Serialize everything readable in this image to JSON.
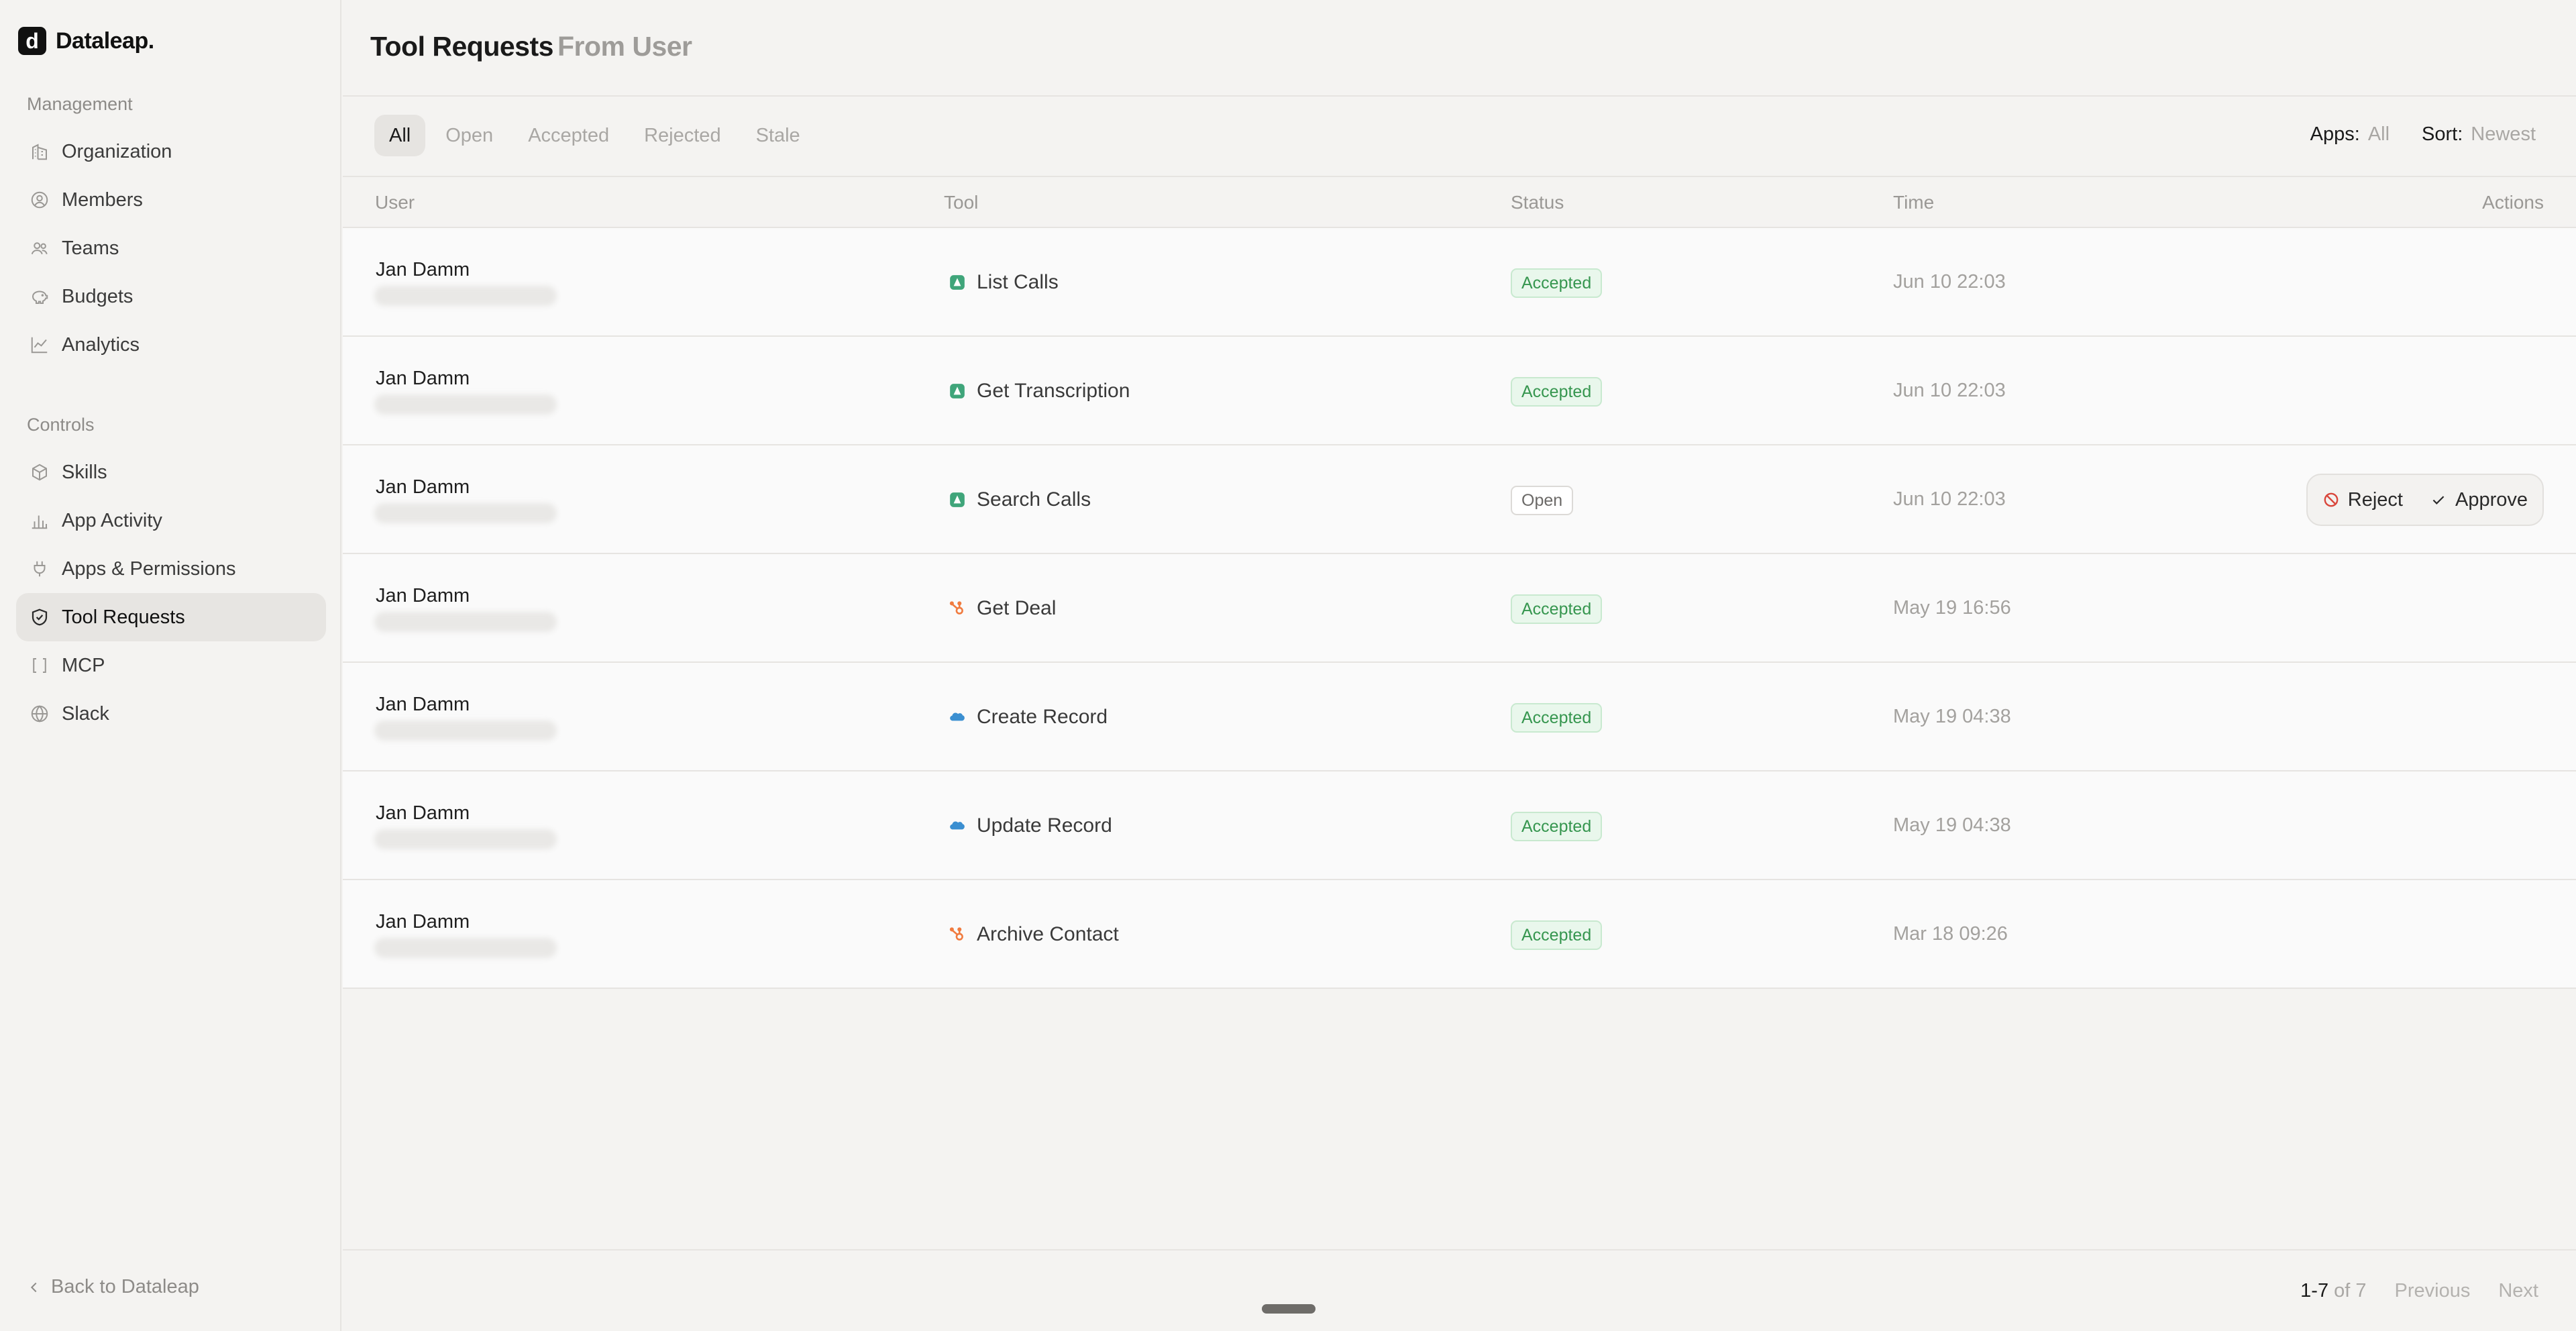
{
  "brand": {
    "logo_letter": "d",
    "name": "Dataleap."
  },
  "sidebar": {
    "sections": [
      {
        "label": "Management",
        "items": [
          {
            "label": "Organization",
            "icon": "building-icon"
          },
          {
            "label": "Members",
            "icon": "user-circle-icon"
          },
          {
            "label": "Teams",
            "icon": "users-icon"
          },
          {
            "label": "Budgets",
            "icon": "piggy-bank-icon"
          },
          {
            "label": "Analytics",
            "icon": "line-chart-icon"
          }
        ]
      },
      {
        "label": "Controls",
        "items": [
          {
            "label": "Skills",
            "icon": "cube-icon"
          },
          {
            "label": "App Activity",
            "icon": "bar-chart-icon"
          },
          {
            "label": "Apps & Permissions",
            "icon": "plug-icon"
          },
          {
            "label": "Tool Requests",
            "icon": "shield-check-icon",
            "active": true
          },
          {
            "label": "MCP",
            "icon": "brackets-icon"
          },
          {
            "label": "Slack",
            "icon": "globe-icon"
          }
        ]
      }
    ],
    "back_label": "Back to Dataleap"
  },
  "header": {
    "title": "Tool Requests",
    "subtitle": "From User"
  },
  "filters": {
    "tabs": [
      "All",
      "Open",
      "Accepted",
      "Rejected",
      "Stale"
    ],
    "active_tab": "All",
    "apps_label": "Apps:",
    "apps_value": "All",
    "sort_label": "Sort:",
    "sort_value": "Newest"
  },
  "table": {
    "columns": {
      "user": "User",
      "tool": "Tool",
      "status": "Status",
      "time": "Time",
      "actions": "Actions"
    },
    "rows": [
      {
        "user": "Jan Damm",
        "tool": "List Calls",
        "app": "gong",
        "status": "Accepted",
        "time": "Jun 10 22:03"
      },
      {
        "user": "Jan Damm",
        "tool": "Get Transcription",
        "app": "gong",
        "status": "Accepted",
        "time": "Jun 10 22:03"
      },
      {
        "user": "Jan Damm",
        "tool": "Search Calls",
        "app": "gong",
        "status": "Open",
        "time": "Jun 10 22:03"
      },
      {
        "user": "Jan Damm",
        "tool": "Get Deal",
        "app": "hubspot",
        "status": "Accepted",
        "time": "May 19 16:56"
      },
      {
        "user": "Jan Damm",
        "tool": "Create Record",
        "app": "salesforce",
        "status": "Accepted",
        "time": "May 19 04:38"
      },
      {
        "user": "Jan Damm",
        "tool": "Update Record",
        "app": "salesforce",
        "status": "Accepted",
        "time": "May 19 04:38"
      },
      {
        "user": "Jan Damm",
        "tool": "Archive Contact",
        "app": "hubspot",
        "status": "Accepted",
        "time": "Mar 18 09:26"
      }
    ],
    "actions": {
      "reject": "Reject",
      "approve": "Approve"
    }
  },
  "pagination": {
    "range": "1-7",
    "of_label": "of 7",
    "previous": "Previous",
    "next": "Next"
  },
  "colors": {
    "gong": "#3fa57a",
    "hubspot": "#f07b3f",
    "salesforce": "#3b8fd1",
    "accepted": "#36964f"
  }
}
